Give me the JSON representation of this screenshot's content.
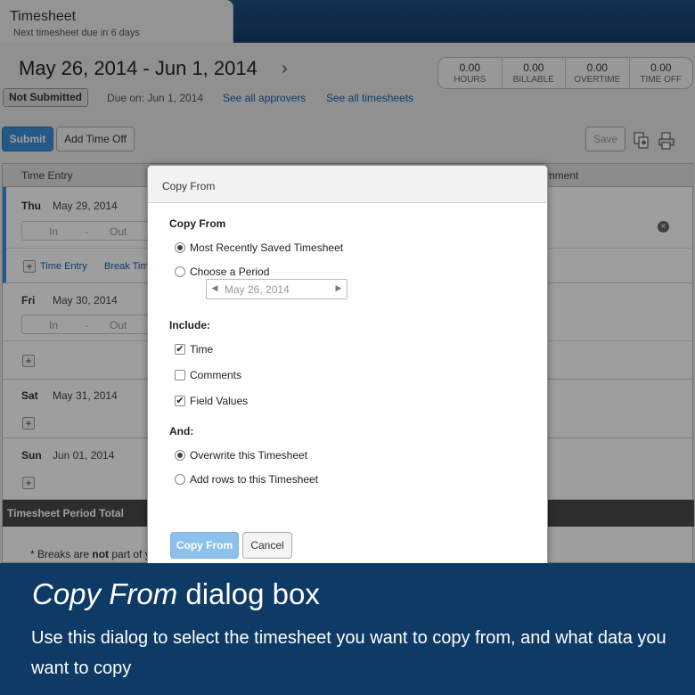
{
  "header": {
    "tab_title": "Timesheet",
    "tab_subtitle": "Next timesheet due in 6 days",
    "period": "May 26, 2014 - Jun 1, 2014",
    "period_next_icon": "chevron-right-icon"
  },
  "stats": [
    {
      "value": "0.00",
      "label": "HOURS"
    },
    {
      "value": "0.00",
      "label": "BILLABLE"
    },
    {
      "value": "0.00",
      "label": "OVERTIME"
    },
    {
      "value": "0.00",
      "label": "TIME OFF"
    }
  ],
  "status": {
    "badge": "Not Submitted",
    "due": "Due on: Jun 1, 2014",
    "approvers_link": "See all approvers",
    "timesheets_link": "See all timesheets"
  },
  "toolbar": {
    "submit_label": "Submit",
    "add_time_off_label": "Add Time Off",
    "save_label": "Save",
    "copy_icon": "copy-icon",
    "print_icon": "print-icon"
  },
  "grid": {
    "col_time_entry": "Time Entry",
    "col_comment": "omment",
    "days": [
      {
        "name": "Thu",
        "date": "May 29, 2014"
      },
      {
        "name": "Fri",
        "date": "May 30, 2014"
      },
      {
        "name": "Sat",
        "date": "May 31, 2014"
      },
      {
        "name": "Sun",
        "date": "Jun 01, 2014"
      }
    ],
    "in_label": "In",
    "dash": "-",
    "out_label": "Out",
    "time_entry_link": "Time Entry",
    "break_link": "Break Tim",
    "total_label": "Timesheet Period Total",
    "note_prefix": "* Breaks are ",
    "note_bold": "not",
    "note_suffix": " part of y"
  },
  "dialog": {
    "title": "Copy From",
    "copy_from_label": "Copy From",
    "copy_options": [
      "Most Recently Saved Timesheet",
      "Choose a Period"
    ],
    "copy_selected": "Most Recently Saved Timesheet",
    "period_value": "May 26, 2014",
    "include_label": "Include:",
    "include_options": [
      {
        "label": "Time",
        "checked": true
      },
      {
        "label": "Comments",
        "checked": false
      },
      {
        "label": "Field Values",
        "checked": true
      }
    ],
    "and_label": "And:",
    "and_options": [
      "Overwrite this Timesheet",
      "Add rows to this Timesheet"
    ],
    "and_selected": "Overwrite this Timesheet",
    "copy_button": "Copy From",
    "cancel_button": "Cancel"
  },
  "caption": {
    "title_italic": "Copy From",
    "title_rest": " dialog box",
    "body": "Use this dialog to select the timesheet you want to copy from, and what data you want to copy"
  },
  "colors": {
    "accent": "#3a8fd8",
    "caption_bg": "#0e3a66",
    "link": "#1d5fa8"
  }
}
